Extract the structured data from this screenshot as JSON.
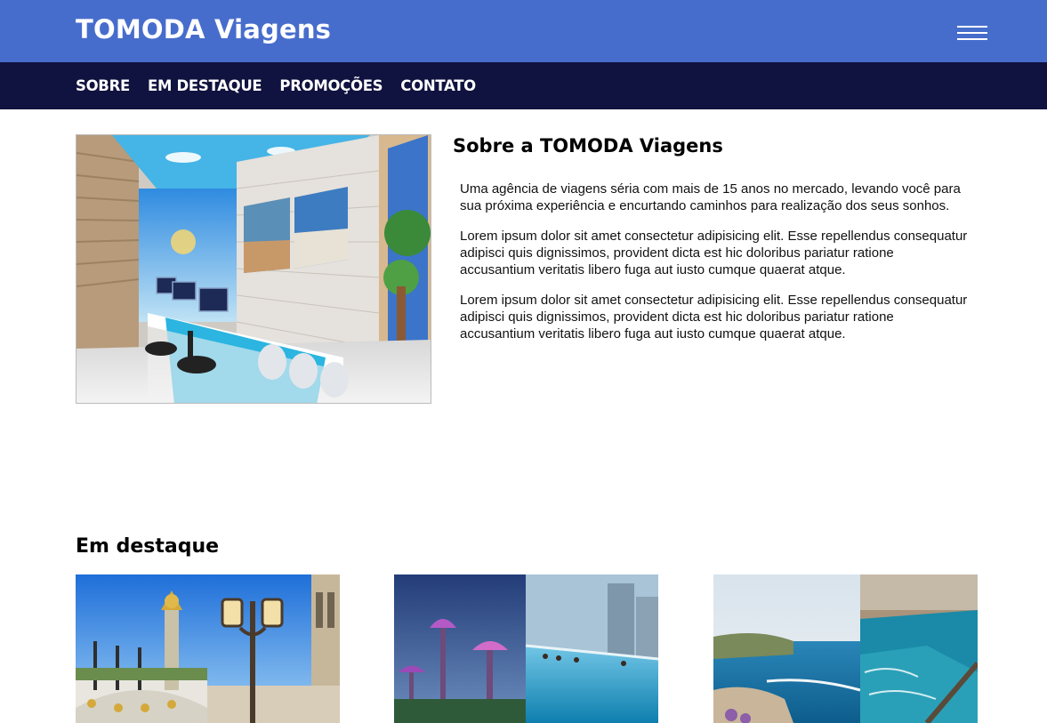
{
  "header": {
    "brand": "TOMODA Viagens",
    "menu_icon": "hamburger-menu-icon"
  },
  "nav": {
    "items": [
      {
        "label": "SOBRE"
      },
      {
        "label": "EM DESTAQUE"
      },
      {
        "label": "PROMOÇÕES"
      },
      {
        "label": "CONTATO"
      }
    ]
  },
  "about": {
    "title": "Sobre a TOMODA Viagens",
    "paragraphs": [
      "Uma agência de viagens séria com mais de 15 anos no mercado, levando você para sua próxima experiência e encurtando caminhos para realização dos seus sonhos.",
      "Lorem ipsum dolor sit amet consectetur adipisicing elit. Esse repellendus consequatur adipisci quis dignissimos, provident dicta est hic doloribus pariatur ratione accusantium veritatis libero fuga aut iusto cumque quaerat atque.",
      "Lorem ipsum dolor sit amet consectetur adipisicing elit. Esse repellendus consequatur adipisci quis dignissimos, provident dicta est hic doloribus pariatur ratione accusantium veritatis libero fuga aut iusto cumque quaerat atque."
    ]
  },
  "featured": {
    "title": "Em destaque"
  },
  "colors": {
    "header_bg": "#476dcc",
    "nav_bg": "#10123f",
    "accent": "#2bb5e0"
  }
}
